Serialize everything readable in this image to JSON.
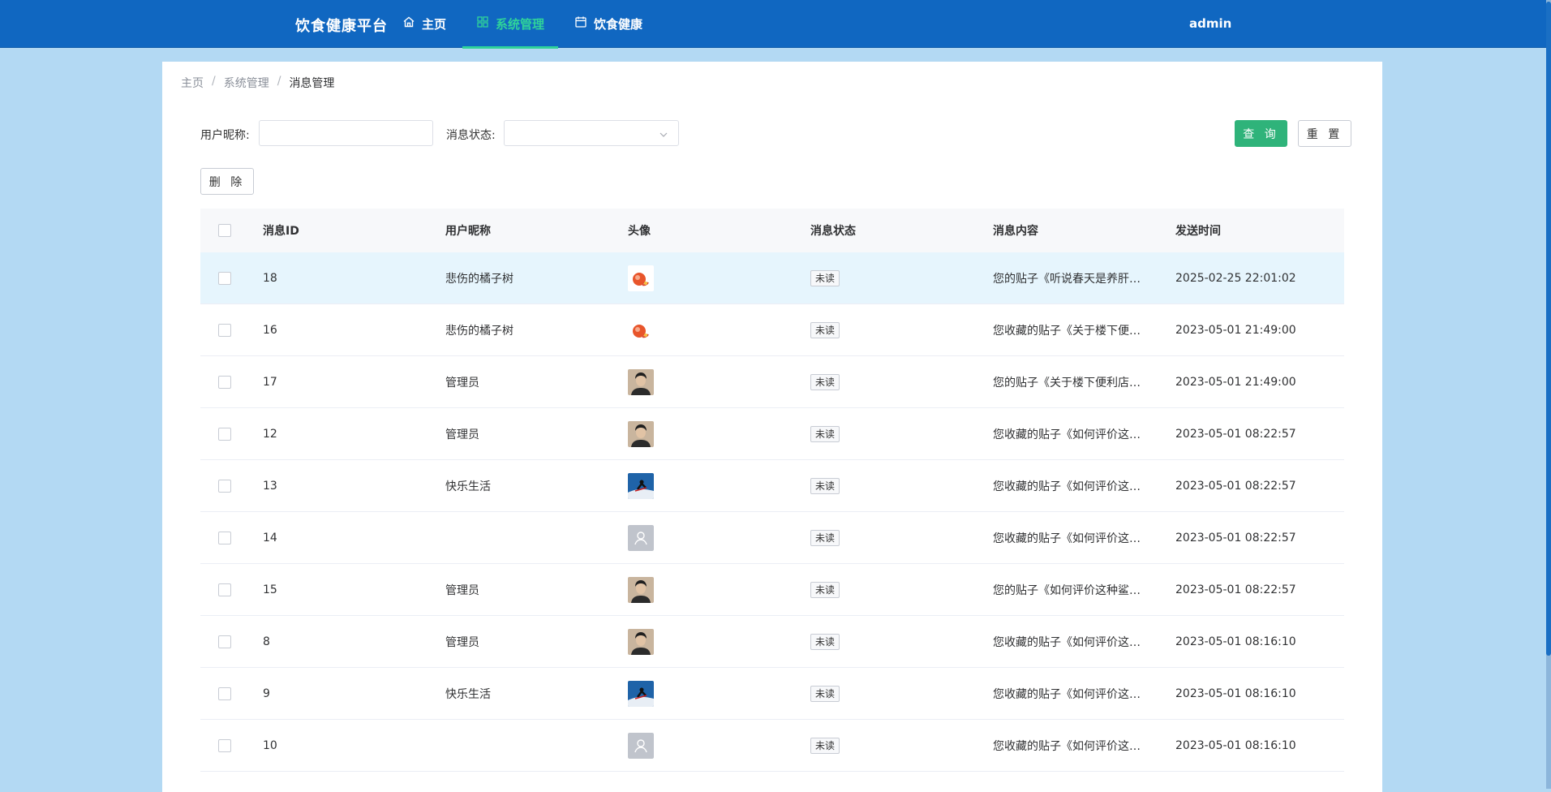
{
  "header": {
    "brand": "饮食健康平台",
    "nav": [
      {
        "label": "主页",
        "icon": "home-icon"
      },
      {
        "label": "系统管理",
        "icon": "grid-icon",
        "active": true
      },
      {
        "label": "饮食健康",
        "icon": "calendar-icon"
      }
    ],
    "user": "admin"
  },
  "breadcrumb": {
    "items": [
      "主页",
      "系统管理",
      "消息管理"
    ],
    "separator": "/"
  },
  "filters": {
    "nickname_label": "用户昵称:",
    "nickname_value": "",
    "status_label": "消息状态:",
    "status_value": "",
    "query_button": "查 询",
    "reset_button": "重 置",
    "delete_button": "删 除"
  },
  "table": {
    "headers": [
      "消息ID",
      "用户昵称",
      "头像",
      "消息状态",
      "消息内容",
      "发送时间"
    ],
    "rows": [
      {
        "id": "18",
        "nickname": "悲伤的橘子树",
        "avatar": "orange-avatar",
        "status": "未读",
        "content": "您的贴子《听说春天是养肝的好季节》",
        "time": "2025-02-25 22:01:02"
      },
      {
        "id": "16",
        "nickname": "悲伤的橘子树",
        "avatar": "orange-avatar",
        "status": "未读",
        "content": "您收藏的贴子《关于楼下便利店》",
        "time": "2023-05-01 21:49:00"
      },
      {
        "id": "17",
        "nickname": "管理员",
        "avatar": "man-avatar",
        "status": "未读",
        "content": "您的贴子《关于楼下便利店的》",
        "time": "2023-05-01 21:49:00"
      },
      {
        "id": "12",
        "nickname": "管理员",
        "avatar": "man-avatar",
        "status": "未读",
        "content": "您收藏的贴子《如何评价这种》",
        "time": "2023-05-01 08:22:57"
      },
      {
        "id": "13",
        "nickname": "快乐生活",
        "avatar": "snow-avatar",
        "status": "未读",
        "content": "您收藏的贴子《如何评价这种》",
        "time": "2023-05-01 08:22:57"
      },
      {
        "id": "14",
        "nickname": "",
        "avatar": "default-avatar",
        "status": "未读",
        "content": "您收藏的贴子《如何评价这种》",
        "time": "2023-05-01 08:22:57"
      },
      {
        "id": "15",
        "nickname": "管理员",
        "avatar": "man-avatar",
        "status": "未读",
        "content": "您的贴子《如何评价这种鲨鱼》",
        "time": "2023-05-01 08:22:57"
      },
      {
        "id": "8",
        "nickname": "管理员",
        "avatar": "man-avatar",
        "status": "未读",
        "content": "您收藏的贴子《如何评价这种》",
        "time": "2023-05-01 08:16:10"
      },
      {
        "id": "9",
        "nickname": "快乐生活",
        "avatar": "snow-avatar",
        "status": "未读",
        "content": "您收藏的贴子《如何评价这种》",
        "time": "2023-05-01 08:16:10"
      },
      {
        "id": "10",
        "nickname": "",
        "avatar": "default-avatar",
        "status": "未读",
        "content": "您收藏的贴子《如何评价这种》",
        "time": "2023-05-01 08:16:10"
      }
    ],
    "highlighted_row": 0
  },
  "colors": {
    "topbar": "#1067c1",
    "accent": "#2fd39a",
    "query": "#2fb37a",
    "page_bg": "#b3d9f3"
  }
}
